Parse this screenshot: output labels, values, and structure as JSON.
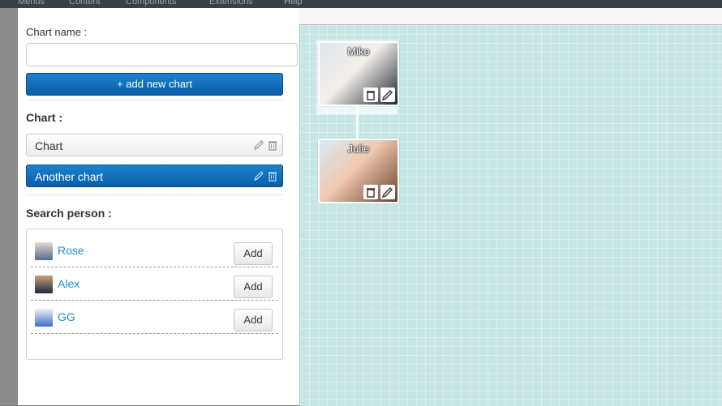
{
  "background": {
    "menu": [
      "Menus",
      "Content",
      "Components",
      "Extensions",
      "Help"
    ]
  },
  "form": {
    "chart_name_label": "Chart name :",
    "chart_name_value": "",
    "add_chart_label": "+ add new chart",
    "chart_section_label": "Chart :",
    "charts": [
      {
        "name": "Chart",
        "active": false
      },
      {
        "name": "Another chart",
        "active": true
      }
    ],
    "search_label": "Search person :",
    "people": [
      {
        "name": "Rose",
        "add_label": "Add"
      },
      {
        "name": "Alex",
        "add_label": "Add"
      },
      {
        "name": "GG",
        "add_label": "Add"
      }
    ]
  },
  "canvas": {
    "nodes": [
      {
        "name": "Mike"
      },
      {
        "name": "Julie"
      }
    ]
  },
  "colors": {
    "primary": "#0b5ea7",
    "link": "#1a8fd0",
    "canvas_bg": "#c6e6e4"
  }
}
